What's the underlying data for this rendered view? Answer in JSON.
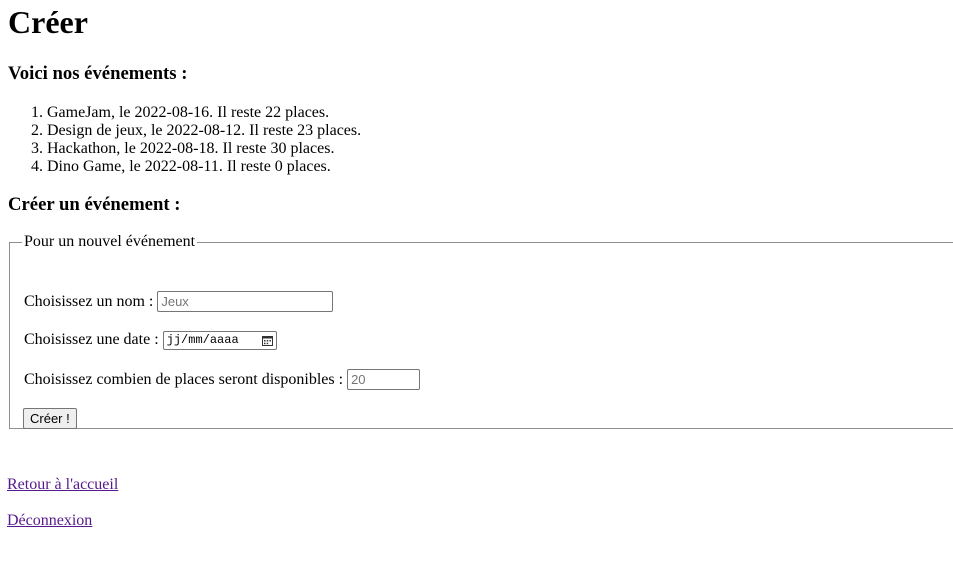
{
  "page": {
    "title": "Créer",
    "events_heading": "Voici nos événements :",
    "create_heading": "Créer un événement :"
  },
  "events": [
    {
      "text": "GameJam, le 2022-08-16. Il reste 22 places."
    },
    {
      "text": "Design de jeux, le 2022-08-12. Il reste 23 places."
    },
    {
      "text": "Hackathon, le 2022-08-18. Il reste 30 places."
    },
    {
      "text": "Dino Game, le 2022-08-11. Il reste 0 places."
    }
  ],
  "form": {
    "legend": "Pour un nouvel événement",
    "name_label": "Choisissez un nom :",
    "name_placeholder": "Jeux",
    "date_label": "Choisissez une date :",
    "date_placeholder": "jj/mm/aaaa",
    "places_label": "Choisissez combien de places seront disponibles :",
    "places_placeholder": "20",
    "submit_label": "Créer !"
  },
  "links": {
    "home": "Retour à l'accueil",
    "logout": "Déconnexion"
  },
  "icons": {
    "date_picker": "calendar-icon"
  },
  "colors": {
    "link_visited": "#551a8b",
    "border": "#767676"
  }
}
